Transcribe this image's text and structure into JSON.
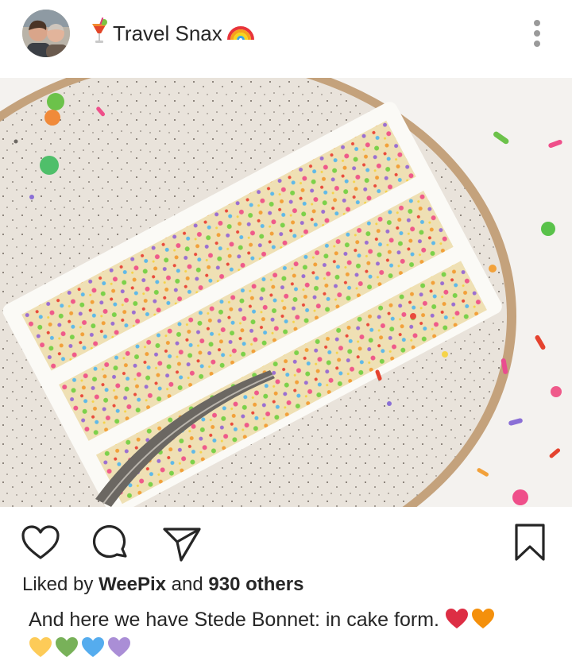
{
  "post": {
    "username": "Travel Snax",
    "username_prefix_icon": "tropical-drink-icon",
    "username_suffix_icon": "rainbow-icon",
    "menu_icon": "more-vertical-icon",
    "image_alt": "Slice of rainbow sprinkle layer cake on a speckled plate with a fork"
  },
  "actions": {
    "like_icon": "heart-outline-icon",
    "comment_icon": "comment-bubble-icon",
    "share_icon": "paper-plane-icon",
    "save_icon": "bookmark-icon"
  },
  "likes": {
    "prefix": "Liked by",
    "user": "WeePix",
    "conjunction": "and",
    "others": "930 others"
  },
  "caption": {
    "text": "And here we have Stede Bonnet: in cake form.",
    "hearts": [
      "#dd2e44",
      "#f4900c",
      "#fdcb58",
      "#78b159",
      "#55acee",
      "#aa8ed6"
    ]
  }
}
